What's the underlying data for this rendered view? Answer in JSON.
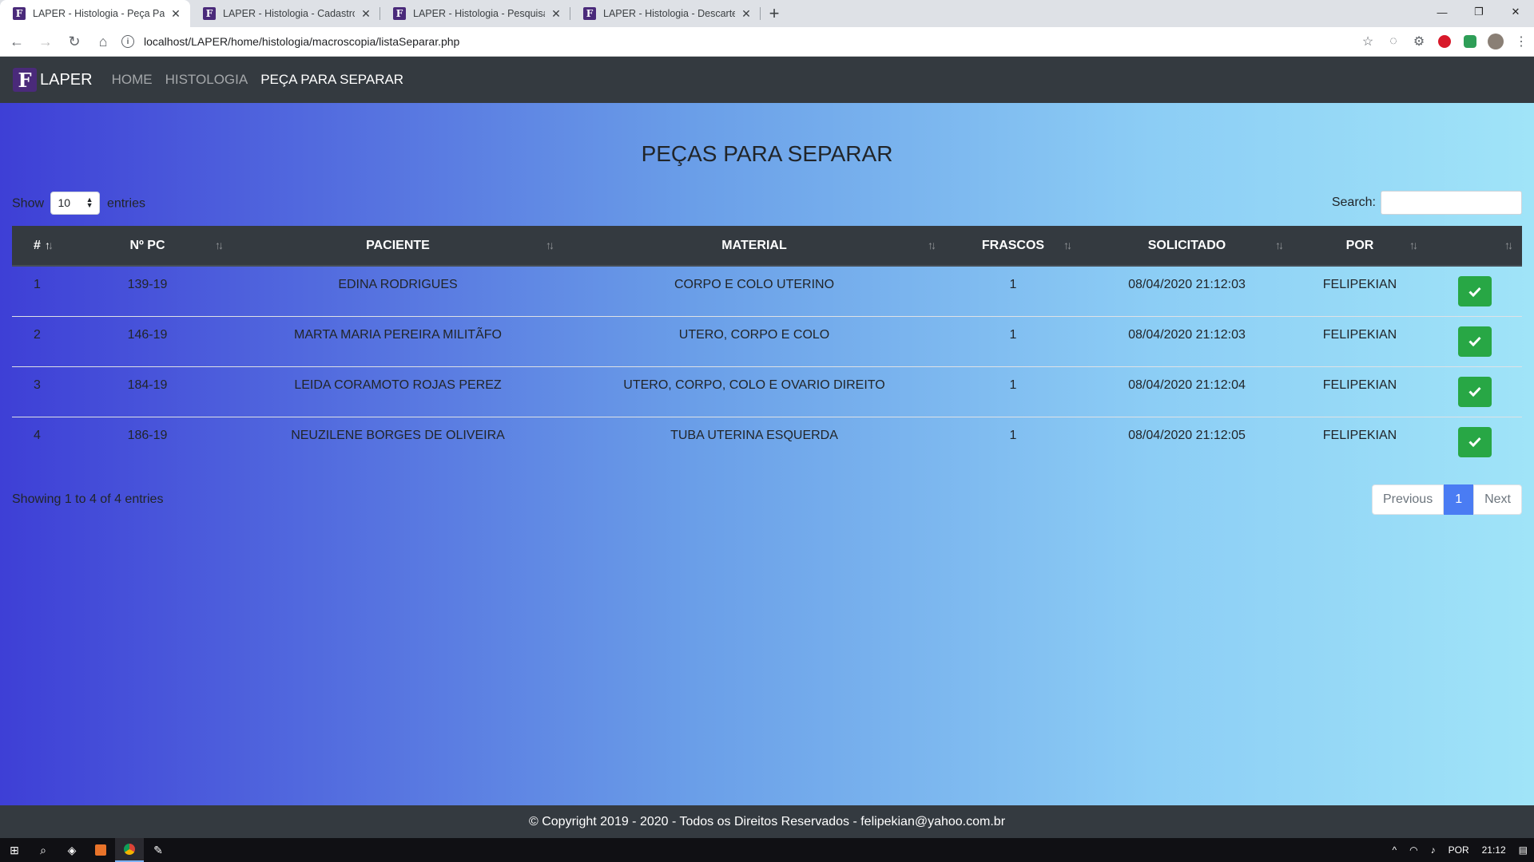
{
  "browser": {
    "tabs": [
      {
        "title": "LAPER - Histologia - Peça Para Se",
        "active": true
      },
      {
        "title": "LAPER - Histologia - Cadastro de",
        "active": false
      },
      {
        "title": "LAPER - Histologia - Pesquisar Re",
        "active": false
      },
      {
        "title": "LAPER - Histologia - Descarte",
        "active": false
      }
    ],
    "url": "localhost/LAPER/home/histologia/macroscopia/listaSeparar.php"
  },
  "navbar": {
    "brand": "LAPER",
    "links": [
      "HOME",
      "HISTOLOGIA",
      "PEÇA PARA SEPARAR"
    ]
  },
  "page": {
    "title": "PEÇAS PARA SEPARAR",
    "show_label": "Show",
    "entries_label": "entries",
    "length_value": "10",
    "search_label": "Search:",
    "search_value": ""
  },
  "table": {
    "columns": [
      "#",
      "Nº PC",
      "PACIENTE",
      "MATERIAL",
      "FRASCOS",
      "SOLICITADO",
      "POR",
      ""
    ],
    "rows": [
      {
        "num": "1",
        "pc": "139-19",
        "paciente": "EDINA RODRIGUES",
        "material": "CORPO E COLO UTERINO",
        "frascos": "1",
        "solicitado": "08/04/2020 21:12:03",
        "por": "FELIPEKIAN"
      },
      {
        "num": "2",
        "pc": "146-19",
        "paciente": "MARTA MARIA PEREIRA MILITÃFO",
        "material": "UTERO, CORPO E COLO",
        "frascos": "1",
        "solicitado": "08/04/2020 21:12:03",
        "por": "FELIPEKIAN"
      },
      {
        "num": "3",
        "pc": "184-19",
        "paciente": "LEIDA CORAMOTO ROJAS PEREZ",
        "material": "UTERO, CORPO, COLO E OVARIO DIREITO",
        "frascos": "1",
        "solicitado": "08/04/2020 21:12:04",
        "por": "FELIPEKIAN"
      },
      {
        "num": "4",
        "pc": "186-19",
        "paciente": "NEUZILENE BORGES DE OLIVEIRA",
        "material": "TUBA UTERINA ESQUERDA",
        "frascos": "1",
        "solicitado": "08/04/2020 21:12:05",
        "por": "FELIPEKIAN"
      }
    ]
  },
  "info": "Showing 1 to 4 of 4 entries",
  "pagination": {
    "previous": "Previous",
    "current": "1",
    "next": "Next"
  },
  "footer": "© Copyright 2019 - 2020 - Todos os Direitos Reservados - felipekian@yahoo.com.br",
  "taskbar": {
    "lang": "POR",
    "time": "21:12"
  },
  "colors": {
    "accent": "#4a7cf3",
    "confirm": "#28a745",
    "dark": "#343a40"
  }
}
